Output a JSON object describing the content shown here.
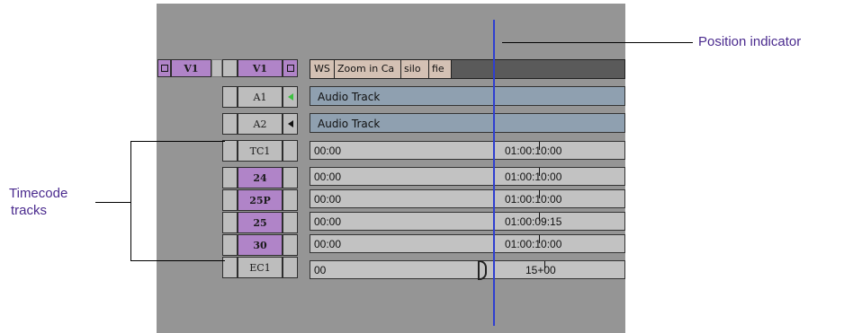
{
  "annotations": {
    "position_indicator": "Position indicator",
    "timecode_tracks_line1": "Timecode",
    "timecode_tracks_line2": "tracks"
  },
  "record_track": {
    "label": "V1"
  },
  "tracks": [
    {
      "label": "V1",
      "style": "purple"
    },
    {
      "label": "A1",
      "style": "gray"
    },
    {
      "label": "A2",
      "style": "gray"
    },
    {
      "label": "TC1",
      "style": "gray"
    },
    {
      "label": "24",
      "style": "purple"
    },
    {
      "label": "25P",
      "style": "purple"
    },
    {
      "label": "25",
      "style": "purple"
    },
    {
      "label": "30",
      "style": "purple"
    },
    {
      "label": "EC1",
      "style": "gray"
    }
  ],
  "video_segments": [
    "WS",
    "Zoom in Ca",
    "silo",
    "fie"
  ],
  "audio_tracks": [
    "Audio Track",
    "Audio Track"
  ],
  "timecode_rows": [
    {
      "left": "00:00",
      "right": "01:00:10:00"
    },
    {
      "left": "00:00",
      "right": "01:00:10:00"
    },
    {
      "left": "00:00",
      "right": "01:00:10:00"
    },
    {
      "left": "00:00",
      "right": "01:00:09:15"
    },
    {
      "left": "00:00",
      "right": "01:00:10:00"
    },
    {
      "left": "00",
      "right": "15+00"
    }
  ],
  "colors": {
    "panel": "#959595",
    "purple": "#b084c8",
    "audio": "#8fa0b0",
    "indicator": "#2f3fd0",
    "callout_text": "#4a2a8e"
  }
}
